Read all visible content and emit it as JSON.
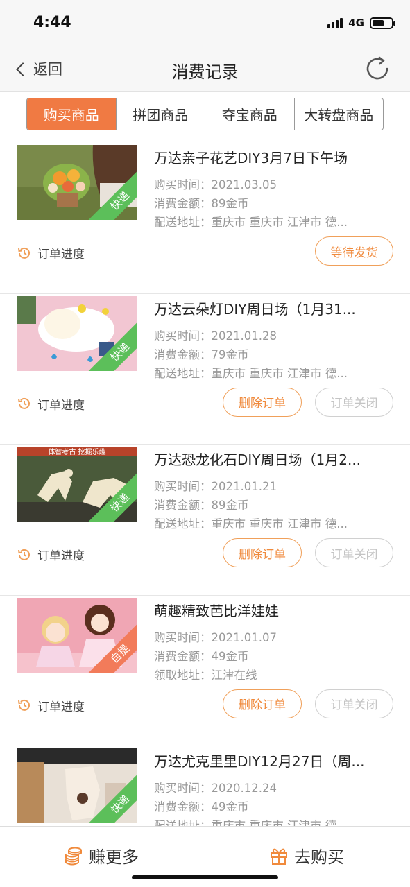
{
  "status_bar": {
    "time": "4:44",
    "network": "4G"
  },
  "nav": {
    "back_label": "返回",
    "title": "消费记录"
  },
  "tabs": [
    {
      "label": "购买商品",
      "active": true
    },
    {
      "label": "拼团商品",
      "active": false
    },
    {
      "label": "夺宝商品",
      "active": false
    },
    {
      "label": "大转盘商品",
      "active": false
    }
  ],
  "colors": {
    "accent": "#f07a43",
    "express_badge": "#5cbf5a",
    "pickup_badge": "#f27b5a"
  },
  "orders": [
    {
      "title": "万达亲子花艺DIY3月7日下午场",
      "badge": "快递",
      "purchase_time": "购买时间：2021.03.05",
      "amount": "消费金额：89金币",
      "address": "配送地址：重庆市 重庆市 江津市 德...",
      "progress_label": "订单进度",
      "primary_button": "等待发货"
    },
    {
      "title": "万达云朵灯DIY周日场（1月31...",
      "badge": "快递",
      "purchase_time": "购买时间：2021.01.28",
      "amount": "消费金额：79金币",
      "address": "配送地址：重庆市 重庆市 江津市 德...",
      "progress_label": "订单进度",
      "delete_button": "删除订单",
      "closed_button": "订单关闭"
    },
    {
      "title": "万达恐龙化石DIY周日场（1月2...",
      "badge": "快递",
      "purchase_time": "购买时间：2021.01.21",
      "amount": "消费金额：89金币",
      "address": "配送地址：重庆市 重庆市 江津市 德...",
      "progress_label": "订单进度",
      "delete_button": "删除订单",
      "closed_button": "订单关闭",
      "image_text": "体智考古 挖掘乐趣"
    },
    {
      "title": "萌趣精致芭比洋娃娃",
      "badge": "自提",
      "purchase_time": "购买时间：2021.01.07",
      "amount": "消费金额：49金币",
      "address": "领取地址：江津在线",
      "progress_label": "订单进度",
      "delete_button": "删除订单",
      "closed_button": "订单关闭"
    },
    {
      "title": "万达尤克里里DIY12月27日（周...",
      "badge": "快递",
      "purchase_time": "购买时间：2020.12.24",
      "amount": "消费金额：49金币",
      "address": "配送地址：重庆市 重庆市 江津市 德..."
    }
  ],
  "bottom_bar": {
    "earn_label": "赚更多",
    "buy_label": "去购买"
  }
}
